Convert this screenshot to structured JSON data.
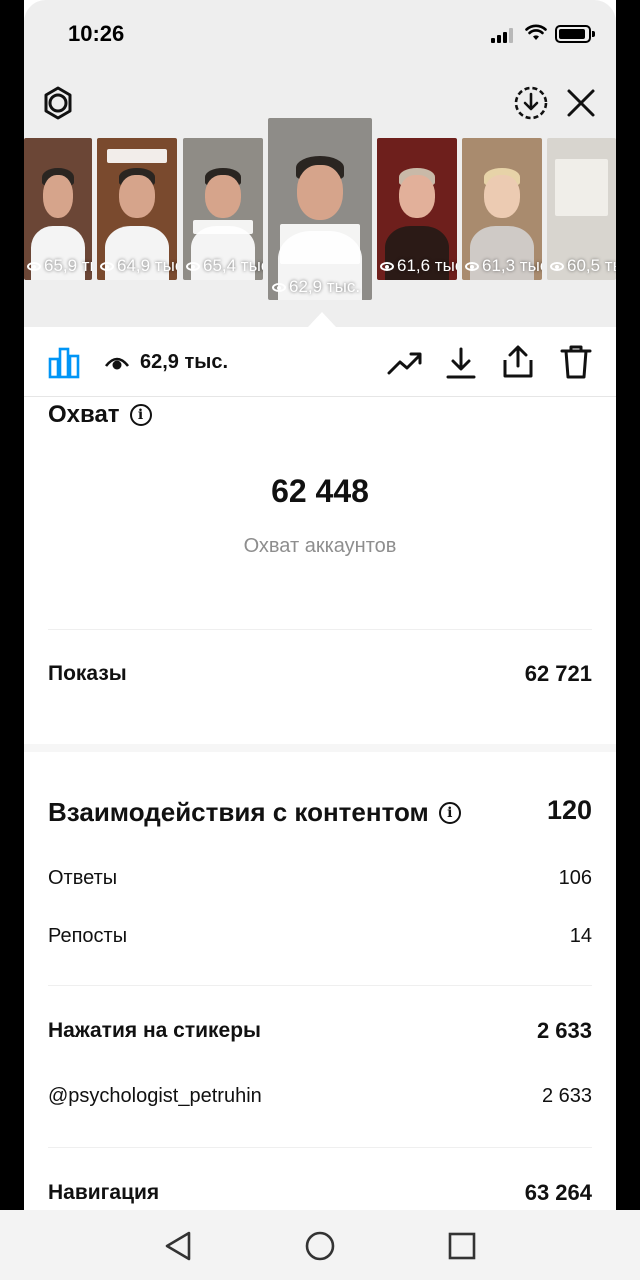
{
  "status_bar": {
    "time": "10:26"
  },
  "thumbnails": [
    {
      "views": "65,9 тыс.",
      "bg": "#6b4636"
    },
    {
      "views": "64,9 тыс.",
      "bg": "#7a4a2e"
    },
    {
      "views": "65,4 тыс.",
      "bg": "#8f8c86"
    },
    {
      "views": "62,9 тыс.",
      "bg": "#8e8c88",
      "active": true
    },
    {
      "views": "61,6 тыс.",
      "bg": "#6e1f1c"
    },
    {
      "views": "61,3 тыс.",
      "bg": "#a98b6e"
    },
    {
      "views": "60,5 тыс.",
      "bg": "#d8d5cf"
    }
  ],
  "toolbar": {
    "views": "62,9 тыс."
  },
  "reach": {
    "title": "Охват",
    "value": "62 448",
    "label": "Охват аккаунтов"
  },
  "impressions": {
    "label": "Показы",
    "value": "62 721"
  },
  "interactions": {
    "title": "Взаимодействия с контентом",
    "value": "120",
    "rows": [
      {
        "label": "Ответы",
        "value": "106"
      },
      {
        "label": "Репосты",
        "value": "14"
      }
    ]
  },
  "sticker_taps": {
    "title": "Нажатия на стикеры",
    "value": "2 633",
    "rows": [
      {
        "label": "@psychologist_petruhin",
        "value": "2 633"
      }
    ]
  },
  "navigation": {
    "title": "Навигация",
    "value": "63 264"
  },
  "colors": {
    "accent": "#0095f6",
    "background": "#ffffff",
    "topzone": "#eeeeee"
  }
}
